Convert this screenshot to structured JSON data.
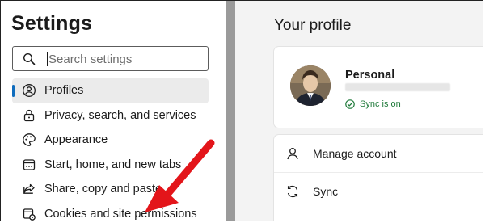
{
  "sidebar": {
    "title": "Settings",
    "search": {
      "placeholder": "Search settings",
      "value": ""
    },
    "items": [
      {
        "label": "Profiles",
        "icon": "profile-icon",
        "active": true
      },
      {
        "label": "Privacy, search, and services",
        "icon": "lock-icon",
        "active": false
      },
      {
        "label": "Appearance",
        "icon": "palette-icon",
        "active": false
      },
      {
        "label": "Start, home, and new tabs",
        "icon": "home-tabs-icon",
        "active": false
      },
      {
        "label": "Share, copy and paste",
        "icon": "share-icon",
        "active": false
      },
      {
        "label": "Cookies and site permissions",
        "icon": "site-permissions-icon",
        "active": false
      }
    ]
  },
  "main": {
    "title": "Your profile",
    "profile": {
      "name": "Personal",
      "sync_status": "Sync is on",
      "avatar": "avatar-photo"
    },
    "actions": [
      {
        "label": "Manage account",
        "icon": "person-icon"
      },
      {
        "label": "Sync",
        "icon": "sync-icon"
      }
    ]
  },
  "colors": {
    "accent": "#0f6cbd",
    "sync_green": "#1f7a3a",
    "arrow_red": "#e3151a",
    "divider": "#9a9a9a"
  }
}
